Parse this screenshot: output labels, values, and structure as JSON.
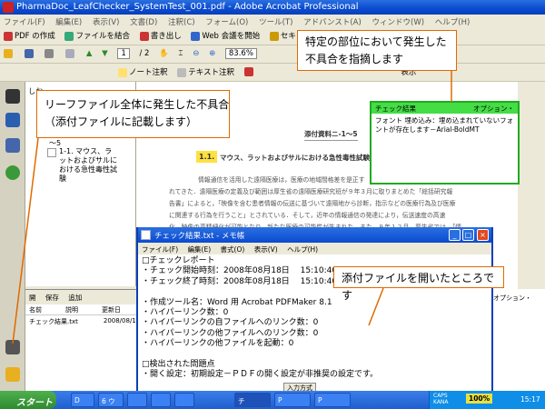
{
  "window": {
    "title": "PharmaDoc_LeafChecker_SystemTest_001.pdf - Adobe Acrobat Professional"
  },
  "menu": [
    "ファイル(F)",
    "編集(E)",
    "表示(V)",
    "文書(D)",
    "注釈(C)",
    "フォーム(O)",
    "ツール(T)",
    "アドバンスト(A)",
    "ウィンドウ(W)",
    "ヘルプ(H)"
  ],
  "toolbar1": {
    "pdf_create": "PDF の作成",
    "combine": "ファイルを結合",
    "export": "書き出し",
    "web_meeting": "Web 会議を開始",
    "security": "セキュリティ"
  },
  "toolbar2": {
    "page_current": "1",
    "page_total": "/ 2",
    "zoom": "83.6%"
  },
  "toolbar3": {
    "note": "ノート注釈",
    "text_edit": "テキスト注釈",
    "display": "表示"
  },
  "nav": {
    "tab": "しお",
    "item1": "1-1. マウス、ラットおよびサルにおける急性毒性試験",
    "item_prefix": "～5"
  },
  "document": {
    "header": "添付資料ニ-1～5",
    "section_num": "1.1.",
    "section_title": "マウス、ラットおよびサルにおける急性毒性試験",
    "para1": "情報通信を活用した遠隔医療は，医療の地域間格差を是正す",
    "para2": "れてきた．遠隔医療の定義及び範囲は厚生省の遠隔医療研究班が９年３月に取りまとめた「総括研究報",
    "para3": "告書」によると，「映像を含む患者情報の伝送に基づいて遠隔地から診断，指示などの医療行為及び医療",
    "para4": "に関連する行為を行うこと」とされている．そして，近年の情報通信の発達により，伝送速度の高速",
    "para5": "化，映像の高精細化が可能となり，新たな医療の可能性が生まれた．また，９年１２月，厚生省では，「情"
  },
  "callouts": {
    "top_right": "特定の部位において発生した\n不具合を指摘します",
    "left": "リーフファイル全体に発生した不具合\n（添付ファイルに記載します）",
    "bottom": "添付ファイルを開いたところです"
  },
  "check_popup": {
    "title": "チェック結果",
    "options": "オプション・",
    "body": "フォント 埋め込み：埋め込まれていないフォントが存在します－Arial-BoldMT"
  },
  "attachments": {
    "open": "開",
    "save": "保存",
    "add": "追加",
    "col_name": "名前",
    "col_desc": "説明",
    "col_mod": "更新日",
    "file_name": "チェック結果.txt",
    "file_date": "2008/08/1"
  },
  "notepad": {
    "title": "チェック結果.txt - メモ帳",
    "menu": [
      "ファイル(F)",
      "編集(E)",
      "書式(O)",
      "表示(V)",
      "ヘルプ(H)"
    ],
    "content": "□チェックレポート\n・チェック開始時刻：2008年08月18日　 15:10:40\n・チェック終了時刻：2008年08月18日　 15:10:40\n\n・作成ツール名：Word 用 Acrobat PDFMaker 8.1\n・ハイパーリンク数：0\n・ハイパーリンクの自ファイルへのリンク数：0\n・ハイパーリンクの他ファイルへのリンク数：0\n・ハイパーリンクの他ファイルを起動：0\n\n□検出された問題点\n・開く設定：初期設定－ＰＤＦの開く設定が非推奨の設定です。",
    "ime": "入力方式"
  },
  "right_panel": {
    "options": "オプション・"
  },
  "taskbar": {
    "start": "スタート",
    "tasks": [
      "D",
      "6 ウ",
      "",
      "",
      "",
      "チ",
      "P",
      "P"
    ],
    "zoom": "100%",
    "clock": "15:17",
    "caps": "CAPS",
    "kana": "KANA"
  }
}
